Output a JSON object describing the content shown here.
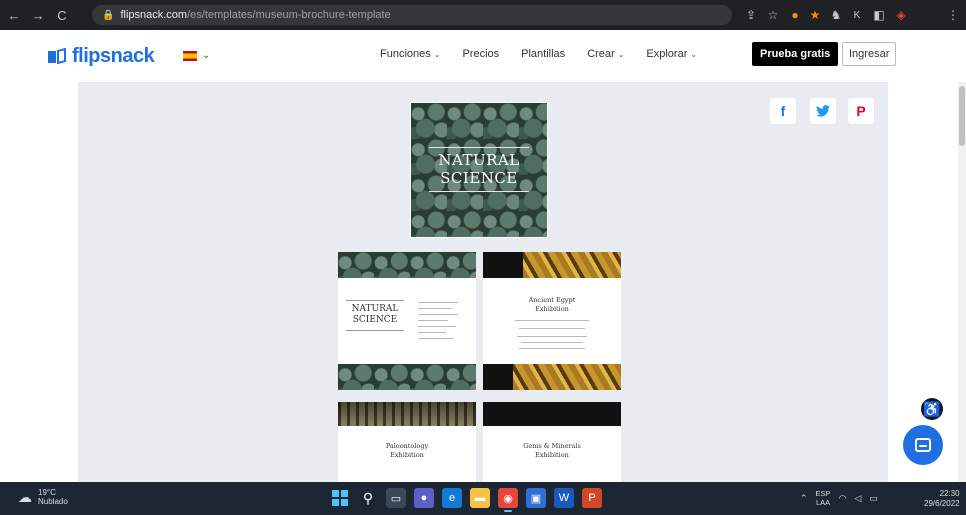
{
  "browser": {
    "back_icon": "←",
    "forward_icon": "→",
    "reload_icon": "C",
    "url_host": "flipsnack.com",
    "url_path": "/es/templates/museum-brochure-template",
    "extension_icons": [
      "share-icon",
      "star-icon",
      "extension-orange-icon",
      "extension-red-icon",
      "extension-dark-icon",
      "extension-k-icon",
      "tabs-icon",
      "profile-icon",
      "menu-icon"
    ]
  },
  "header": {
    "logo": "flipsnack",
    "nav": {
      "features": "Funciones",
      "pricing": "Precios",
      "templates": "Plantillas",
      "create": "Crear",
      "explore": "Explorar"
    },
    "try_free": "Prueba gratis",
    "login": "Ingresar"
  },
  "share": {
    "facebook": "f",
    "twitter": "t",
    "pinterest": "P"
  },
  "brochure": {
    "cover_title_1": "NATURAL",
    "cover_title_2": "SCIENCE",
    "page1_title_1": "NATURAL",
    "page1_title_2": "SCIENCE",
    "page2_title_1": "Ancient Egypt",
    "page2_title_2": "Exhibition",
    "page3_title_1": "Paleontology",
    "page3_title_2": "Exhibition",
    "page4_title_1": "Gems & Minerals",
    "page4_title_2": "Exhibition"
  },
  "taskbar": {
    "weather_temp": "19°C",
    "weather_cond": "Nublado",
    "language": "ESP",
    "layout": "LAA",
    "time": "22:30",
    "date": "29/6/2022"
  },
  "colors": {
    "brand_blue": "#1f6fe0",
    "content_bg": "#e8ecf1",
    "taskbar_bg": "#1d2733"
  }
}
